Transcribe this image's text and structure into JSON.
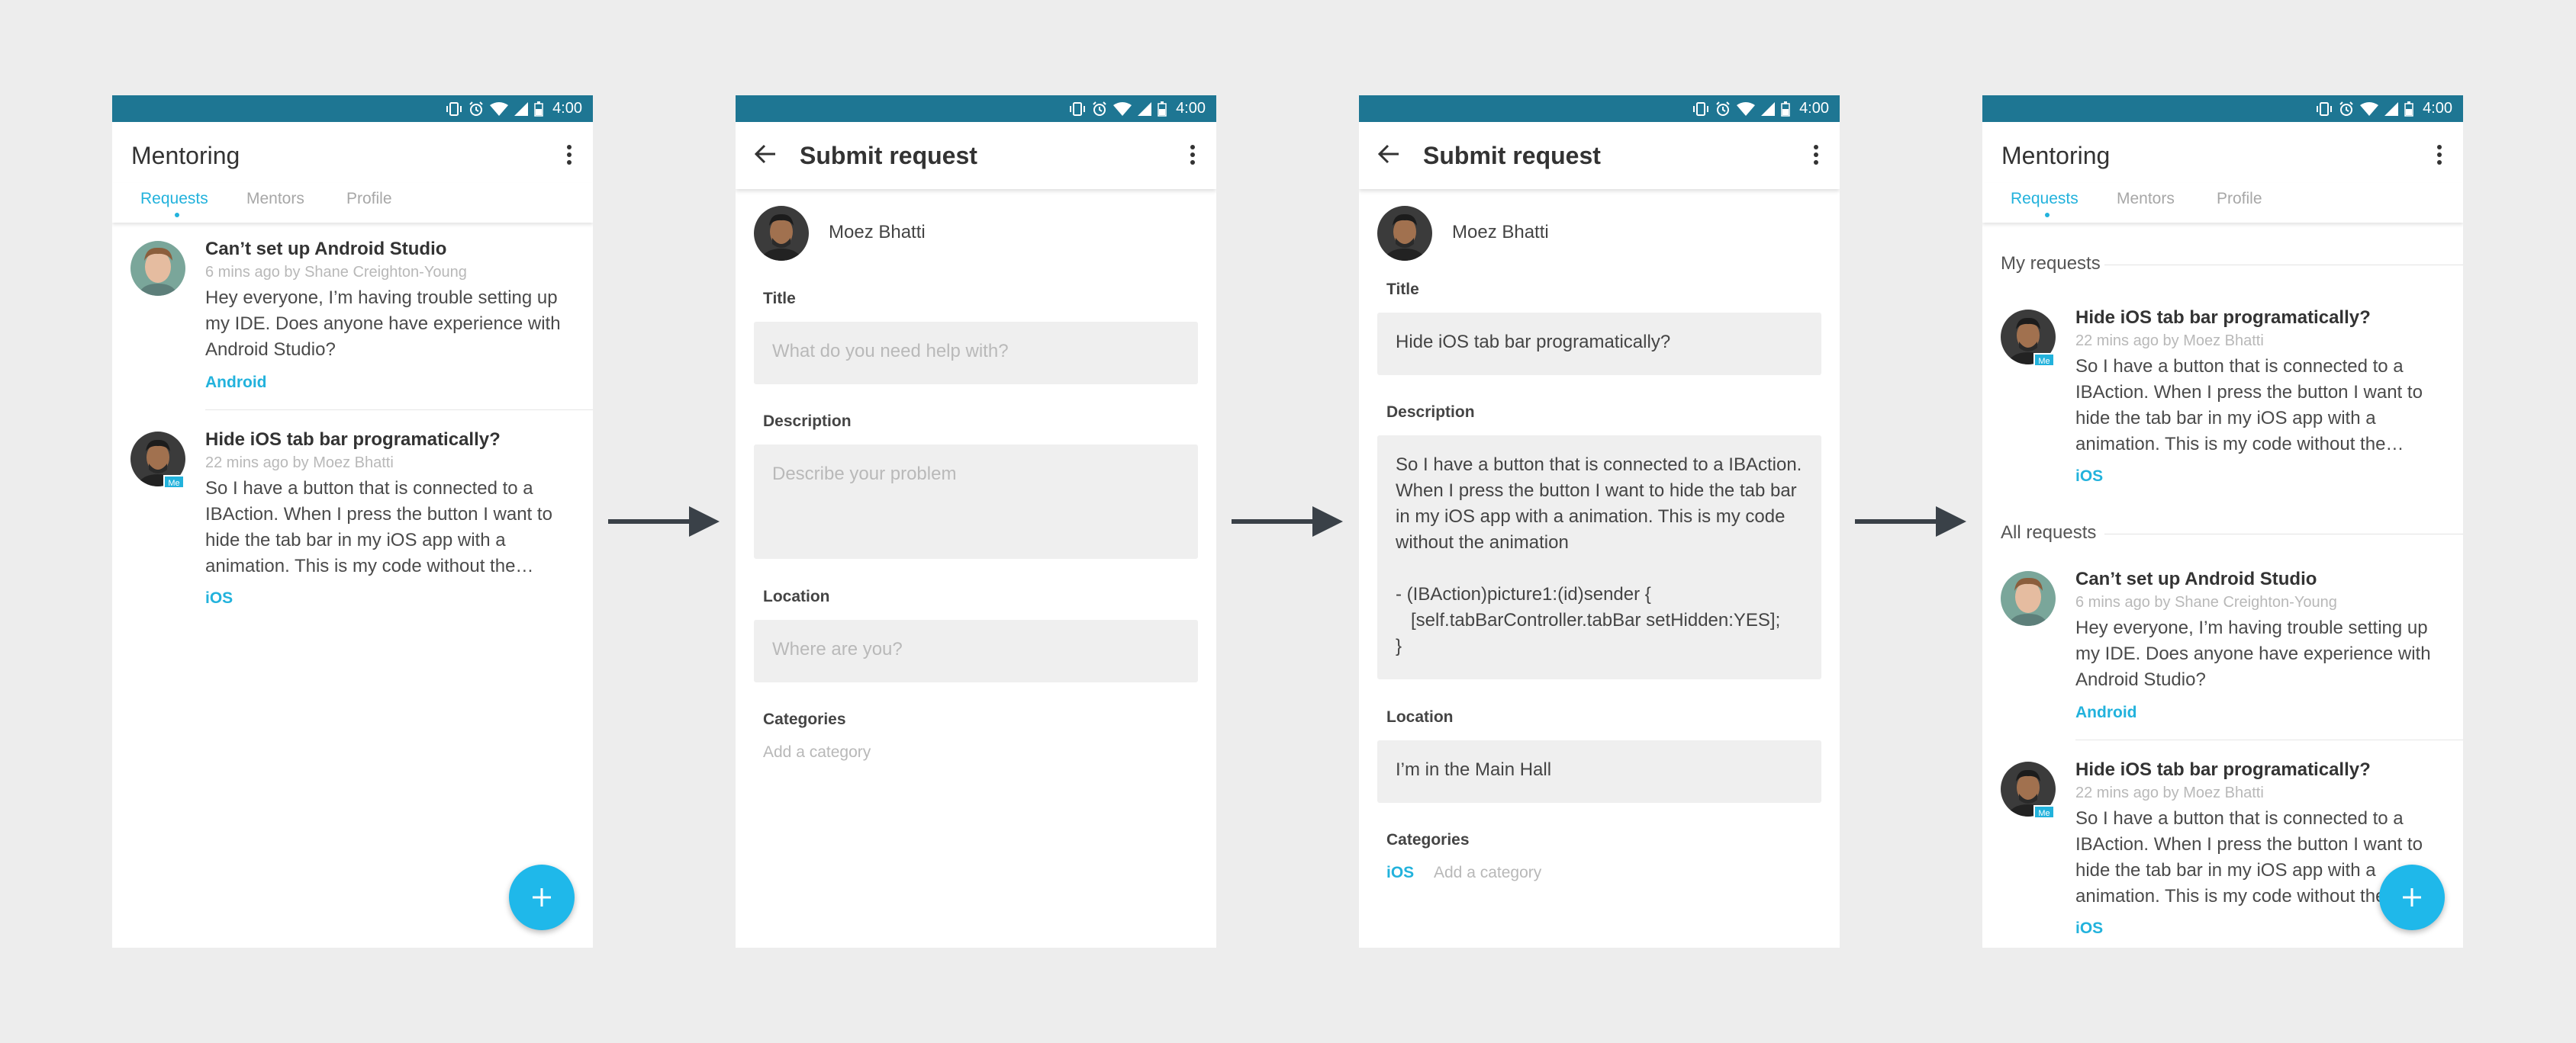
{
  "status": {
    "time": "4:00"
  },
  "colors": {
    "status_bar": "#1e7693",
    "accent": "#22b2dc",
    "fab": "#1fb8ea",
    "background": "#ededed"
  },
  "screen1": {
    "title": "Mentoring",
    "tabs": [
      "Requests",
      "Mentors",
      "Profile"
    ],
    "posts": [
      {
        "title": "Can’t set up Android Studio",
        "meta": "6 mins ago by Shane Creighton-Young",
        "body": "Hey everyone, I’m having trouble setting up my IDE. Does anyone have experience with Android Studio?",
        "tag": "Android"
      },
      {
        "title": "Hide iOS tab bar programatically?",
        "meta": "22 mins ago by Moez Bhatti",
        "body": "So I have a button that is connected to a IBAction. When I press the button I want to hide the tab bar in my iOS app with a animation. This is my code without the…",
        "tag": "iOS",
        "badge": "Me"
      }
    ],
    "fab_icon": "plus-icon"
  },
  "screen2": {
    "title": "Submit request",
    "author": "Moez Bhatti",
    "title_label": "Title",
    "title_placeholder": "What do you need help with?",
    "description_label": "Description",
    "description_placeholder": "Describe your problem",
    "location_label": "Location",
    "location_placeholder": "Where are you?",
    "categories_label": "Categories",
    "add_category": "Add a category"
  },
  "screen3": {
    "title": "Submit request",
    "author": "Moez Bhatti",
    "title_label": "Title",
    "title_value": "Hide iOS tab bar programatically?",
    "description_label": "Description",
    "description_value": "So I have a button that is connected to a IBAction. When I press the button I want to hide the tab bar in my iOS app with a animation. This is my code without the animation\n\n- (IBAction)picture1:(id)sender {\n   [self.tabBarController.tabBar setHidden:YES];\n}",
    "location_label": "Location",
    "location_value": "I’m in the Main Hall",
    "categories_label": "Categories",
    "category": "iOS",
    "add_category": "Add a category"
  },
  "screen4": {
    "title": "Mentoring",
    "tabs": [
      "Requests",
      "Mentors",
      "Profile"
    ],
    "my_requests_label": "My requests",
    "all_requests_label": "All requests",
    "my_post": {
      "title": "Hide iOS tab bar programatically?",
      "meta": "22 mins ago by Moez Bhatti",
      "body": "So I have a button that is connected to a IBAction. When I press the button I want to hide the tab bar in my iOS app with a animation. This is my code without the…",
      "tag": "iOS",
      "badge": "Me"
    },
    "all_posts": [
      {
        "title": "Can’t set up Android Studio",
        "meta": "6 mins ago by Shane Creighton-Young",
        "body": "Hey everyone, I’m having trouble setting up my IDE. Does anyone have experience with Android Studio?",
        "tag": "Android"
      },
      {
        "title": "Hide iOS tab bar programatically?",
        "meta": "22 mins ago by Moez Bhatti",
        "body": "So I have a button that is connected to a IBAction. When I press the button I want to hide the tab bar in my iOS app with a animation. This is my code without the…",
        "tag": "iOS",
        "badge": "Me"
      }
    ]
  }
}
